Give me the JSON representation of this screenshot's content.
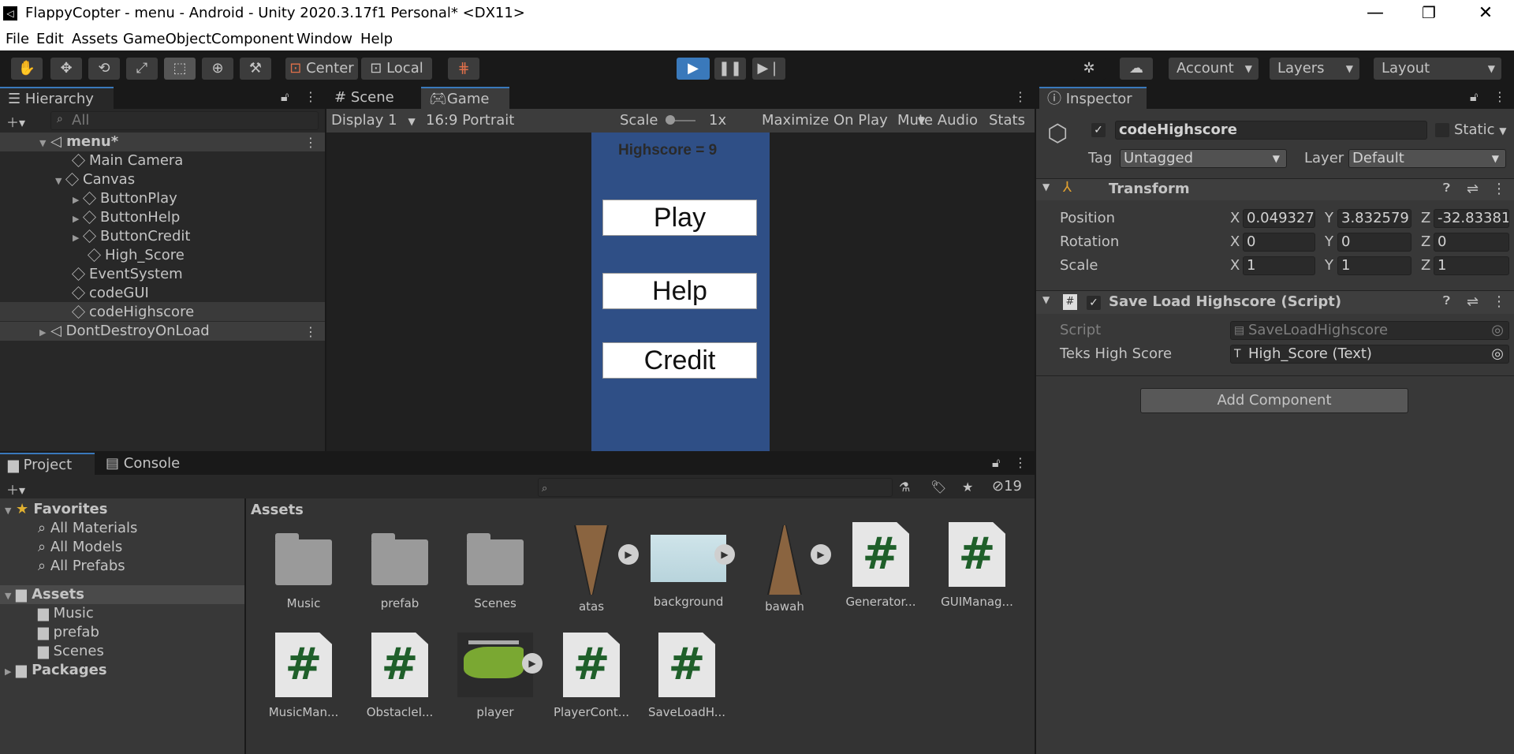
{
  "window": {
    "title": "FlappyCopter - menu - Android - Unity 2020.3.17f1 Personal* <DX11>",
    "minimize": "—",
    "restore": "❐",
    "close": "✕"
  },
  "menu": [
    "File",
    "Edit",
    "Assets",
    "GameObject",
    "Component",
    "Window",
    "Help"
  ],
  "toolbar": {
    "pivot": "Center",
    "space": "Local",
    "account": "Account",
    "layers": "Layers",
    "layout": "Layout"
  },
  "hierarchy": {
    "tab": "Hierarchy",
    "search_placeholder": "All",
    "items": [
      {
        "label": "menu*"
      },
      {
        "label": "Main Camera"
      },
      {
        "label": "Canvas"
      },
      {
        "label": "ButtonPlay"
      },
      {
        "label": "ButtonHelp"
      },
      {
        "label": "ButtonCredit"
      },
      {
        "label": "High_Score"
      },
      {
        "label": "EventSystem"
      },
      {
        "label": "codeGUI"
      },
      {
        "label": "codeHighscore"
      },
      {
        "label": "DontDestroyOnLoad"
      }
    ]
  },
  "center_tabs": {
    "scene": "Scene",
    "game": "Game"
  },
  "game_bar": {
    "display": "Display 1",
    "aspect": "16:9 Portrait",
    "scale_label": "Scale",
    "scale_value": "1x",
    "maximize": "Maximize On Play",
    "mute": "Mute Audio",
    "stats": "Stats"
  },
  "game_view": {
    "highscore": "Highscore = 9",
    "buttons": [
      "Play",
      "Help",
      "Credit"
    ],
    "bg_color": "#2f4f86"
  },
  "inspector": {
    "tab": "Inspector",
    "object_name": "codeHighscore",
    "static": "Static",
    "tag_label": "Tag",
    "tag": "Untagged",
    "layer_label": "Layer",
    "layer": "Default",
    "transform": {
      "title": "Transform",
      "position_label": "Position",
      "rotation_label": "Rotation",
      "scale_label": "Scale",
      "position": {
        "x": "0.049327",
        "y": "3.832579",
        "z": "-32.83381"
      },
      "rotation": {
        "x": "0",
        "y": "0",
        "z": "0"
      },
      "scale": {
        "x": "1",
        "y": "1",
        "z": "1"
      }
    },
    "script_comp": {
      "title": "Save Load Highscore (Script)",
      "script_label": "Script",
      "script_value": "SaveLoadHighscore",
      "teks_label": "Teks High Score",
      "teks_value": "High_Score (Text)"
    },
    "add_component": "Add Component"
  },
  "project": {
    "tab_project": "Project",
    "tab_console": "Console",
    "hidden_count": "19",
    "favorites": {
      "label": "Favorites",
      "items": [
        "All Materials",
        "All Models",
        "All Prefabs"
      ]
    },
    "assets_tree": {
      "label": "Assets",
      "items": [
        "Music",
        "prefab",
        "Scenes"
      ]
    },
    "packages": "Packages",
    "breadcrumb": "Assets",
    "assets": [
      {
        "name": "Music",
        "kind": "folder"
      },
      {
        "name": "prefab",
        "kind": "folder"
      },
      {
        "name": "Scenes",
        "kind": "folder"
      },
      {
        "name": "atas",
        "kind": "sprite"
      },
      {
        "name": "background",
        "kind": "image"
      },
      {
        "name": "bawah",
        "kind": "sprite"
      },
      {
        "name": "Generator...",
        "kind": "script"
      },
      {
        "name": "GUIManag...",
        "kind": "script"
      },
      {
        "name": "MusicMan...",
        "kind": "script"
      },
      {
        "name": "ObstacleI...",
        "kind": "script"
      },
      {
        "name": "player",
        "kind": "sprite"
      },
      {
        "name": "PlayerCont...",
        "kind": "script"
      },
      {
        "name": "SaveLoadH...",
        "kind": "script"
      }
    ]
  }
}
